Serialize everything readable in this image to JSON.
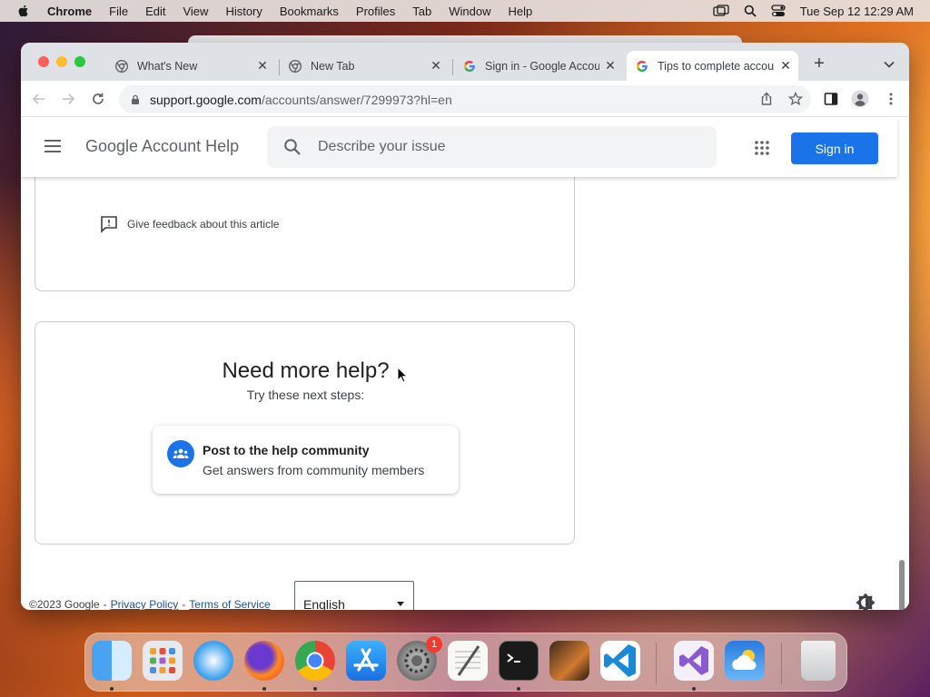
{
  "menubar": {
    "app_name": "Chrome",
    "items": [
      "File",
      "Edit",
      "View",
      "History",
      "Bookmarks",
      "Profiles",
      "Tab",
      "Window",
      "Help"
    ],
    "clock": "Tue Sep 12  12:29 AM"
  },
  "tabs": [
    {
      "title": "What's New",
      "favicon": "chrome-icon"
    },
    {
      "title": "New Tab",
      "favicon": "chrome-icon"
    },
    {
      "title": "Sign in - Google Accounts",
      "favicon": "google-icon"
    },
    {
      "title": "Tips to complete account recovery",
      "favicon": "google-icon",
      "active": true
    }
  ],
  "address_bar": {
    "host": "support.google.com",
    "path": "/accounts/answer/7299973?hl=en"
  },
  "help_header": {
    "title": "Google Account Help",
    "search_placeholder": "Describe your issue",
    "sign_in_label": "Sign in"
  },
  "feedback": {
    "label": "Give feedback about this article"
  },
  "need_help": {
    "heading": "Need more help?",
    "subheading": "Try these next steps:",
    "community_title": "Post to the help community",
    "community_subtitle": "Get answers from community members"
  },
  "footer": {
    "copyright": "©2023 Google",
    "privacy": "Privacy Policy",
    "terms": "Terms of Service",
    "language": "English"
  },
  "dock": {
    "apps": [
      "finder-icon",
      "launchpad-icon",
      "safari-icon",
      "firefox-icon",
      "chrome-icon",
      "app-store-icon",
      "system-settings-icon",
      "textedit-icon",
      "terminal-icon",
      "garageband-icon",
      "vscode-icon",
      "visual-studio-icon",
      "weather-icon",
      "trash-icon"
    ],
    "settings_badge": "1"
  },
  "colors": {
    "accent": "#1a73e8",
    "tab_strip": "#dee1e6"
  }
}
